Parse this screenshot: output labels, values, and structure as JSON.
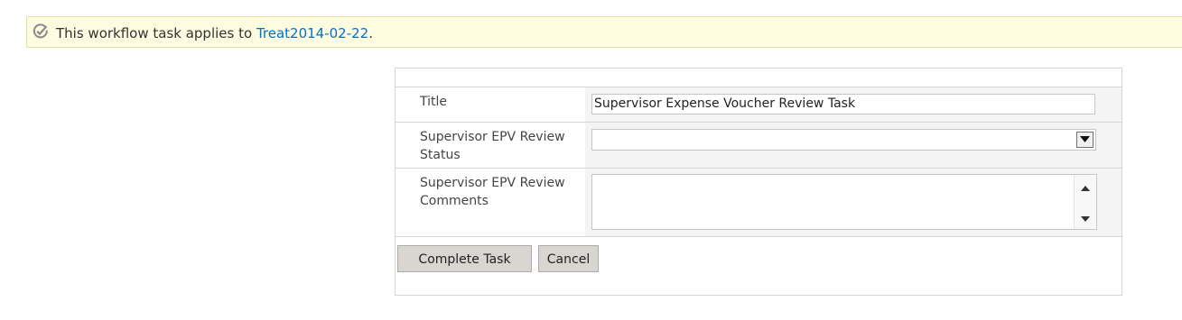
{
  "banner": {
    "text_prefix": "This workflow task applies to ",
    "link_text": "Treat2014-02-22",
    "text_suffix": "."
  },
  "form": {
    "fields": [
      {
        "label": "Title",
        "value": "Supervisor Expense Voucher Review Task",
        "type": "text"
      },
      {
        "label": "Supervisor EPV Review Status",
        "value": "",
        "type": "select"
      },
      {
        "label": "Supervisor EPV Review Comments",
        "value": "",
        "type": "textarea"
      }
    ],
    "buttons": {
      "complete": "Complete Task",
      "cancel": "Cancel"
    }
  },
  "icons": {
    "banner_icon": "check-circle-icon",
    "dropdown_icon": "chevron-down-icon",
    "scroll_up_icon": "scroll-up-arrow-icon",
    "scroll_down_icon": "scroll-down-arrow-icon"
  },
  "colors": {
    "banner_bg": "#fdfbe0",
    "link": "#0072c6",
    "button_bg": "#d9d6d1"
  }
}
